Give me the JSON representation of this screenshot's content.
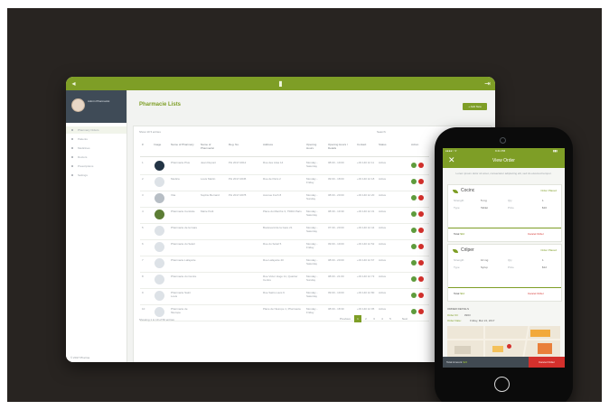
{
  "tablet": {
    "profile_name": "Admin Pharmacist",
    "menu": [
      "Pharmacy Orders",
      "Patients",
      "Medicines",
      "Doctors",
      "Prescriptions",
      "Settings"
    ],
    "footer": "© 2017 Pharma",
    "title": "Pharmacie Lists",
    "add_label": "+ Add New",
    "filter_left": "Show 10 ▾ entries",
    "filter_right": "Search:",
    "columns": [
      "#",
      "Image",
      "Name of Pharmacy",
      "Name of Pharmacist",
      "Reg. No.",
      "Address",
      "Opening Hours",
      "Opening Hours / Details",
      "Contact",
      "Status",
      "Action"
    ],
    "rows": [
      {
        "num": "1",
        "name": "Pharmacie Plus",
        "pharmacist": "Jean Dupont",
        "reg": "PH 2017-0012",
        "address": "Rue des Lilas 14",
        "days": "Monday - Saturday",
        "hours": "08:00 - 19:00",
        "contact": "+33 140 12 11",
        "status": "Active",
        "thumb": "dark"
      },
      {
        "num": "2",
        "name": "Medica",
        "pharmacist": "Louis Martin",
        "reg": "PH 2017-0045",
        "address": "Rue de Paris 2",
        "days": "Monday - Friday",
        "hours": "09:00 - 18:00",
        "contact": "+33 140 12 18",
        "status": "Active",
        "thumb": "light"
      },
      {
        "num": "3",
        "name": "Vita",
        "pharmacist": "Sophie Bernard",
        "reg": "PH 2017-0078",
        "address": "Avenue Foch 8",
        "days": "Monday - Sunday",
        "hours": "08:00 - 20:00",
        "contact": "+33 140 12 20",
        "status": "Active",
        "thumb": "grey"
      },
      {
        "num": "4",
        "name": "Pharmacie Centrale",
        "pharmacist": "Marie Petit",
        "reg": "",
        "address": "Place du Marché 3, 75004 Paris",
        "days": "Monday - Saturday",
        "hours": "08:30 - 19:30",
        "contact": "+33 140 12 31",
        "status": "Active",
        "thumb": "green"
      },
      {
        "num": "5",
        "name": "Pharmacie de la Gare",
        "pharmacist": "",
        "reg": "",
        "address": "Boulevard de la Gare 21",
        "days": "Monday - Saturday",
        "hours": "07:30 - 20:00",
        "contact": "+33 140 12 44",
        "status": "Active",
        "thumb": "light"
      },
      {
        "num": "6",
        "name": "Pharmacie du Soleil",
        "pharmacist": "",
        "reg": "",
        "address": "Rue du Soleil 5",
        "days": "Monday - Friday",
        "hours": "09:00 - 19:00",
        "contact": "+33 140 12 52",
        "status": "Active",
        "thumb": "light"
      },
      {
        "num": "7",
        "name": "Pharmacie Lafayette",
        "pharmacist": "",
        "reg": "",
        "address": "Rue Lafayette 40",
        "days": "Monday - Saturday",
        "hours": "08:00 - 20:00",
        "contact": "+33 140 12 67",
        "status": "Active",
        "thumb": "light"
      },
      {
        "num": "8",
        "name": "Pharmacie du Centre",
        "pharmacist": "",
        "reg": "",
        "address": "Rue Victor Hugo 11, Quartier Centre",
        "days": "Monday - Sunday",
        "hours": "08:00 - 21:00",
        "contact": "+33 140 12 73",
        "status": "Active",
        "thumb": "light"
      },
      {
        "num": "9",
        "name": "Pharmacie Saint Louis",
        "pharmacist": "",
        "reg": "",
        "address": "Rue Saint-Louis 9",
        "days": "Monday - Saturday",
        "hours": "09:00 - 19:00",
        "contact": "+33 140 12 80",
        "status": "Active",
        "thumb": "light"
      },
      {
        "num": "10",
        "name": "Pharmacie de l'Europe",
        "pharmacist": "",
        "reg": "",
        "address": "Place de l'Europe 1, Pharmacie",
        "days": "Monday - Friday",
        "hours": "08:00 - 18:30",
        "contact": "+33 140 12 95",
        "status": "Active",
        "thumb": "light"
      }
    ],
    "pager_note": "Showing 1 to 10 of 50 entries",
    "pages": [
      "Previous",
      "1",
      "2",
      "3",
      "4",
      "5",
      "Next"
    ]
  },
  "phone": {
    "carrier": "●●●●○ ᯤ",
    "time": "9:41 PM",
    "battery": "▮▮▮",
    "close_icon": "✕",
    "title": "View Order",
    "note": "Lorem ipsum dolor sit amet, consectetur adipiscing elit, sed do eiusmod tempor.",
    "orders": [
      {
        "name": "Cocinc",
        "status": "Order Placed",
        "labels": [
          "Strength",
          "Qty",
          "Type",
          "Price"
        ],
        "values": [
          "5 mg",
          "1",
          "Tablet",
          "$10"
        ],
        "total_label": "Total",
        "total": "$10",
        "cancel": "Cancel Order"
      },
      {
        "name": "Crilper",
        "status": "Order Placed",
        "labels": [
          "Strength",
          "Qty",
          "Type",
          "Price"
        ],
        "values": [
          "10 mg",
          "1",
          "Syrup",
          "$12"
        ],
        "total_label": "Total",
        "total": "$12",
        "cancel": "Cancel Order"
      }
    ],
    "details_heading": "ORDER DETAILS",
    "order_id_label": "Order ID:",
    "order_id": "#963",
    "order_date_label": "Order Date:",
    "order_date": "Friday, Mar 24, 2017",
    "user_label": "User Name",
    "total_amount_label": "Total Amount",
    "total_amount": "$22",
    "cancel_all": "Cancel Order"
  },
  "colors": {
    "accent": "#7e9e26",
    "danger": "#d4302c",
    "approve": "#5e9b3c",
    "background": "#282421"
  }
}
